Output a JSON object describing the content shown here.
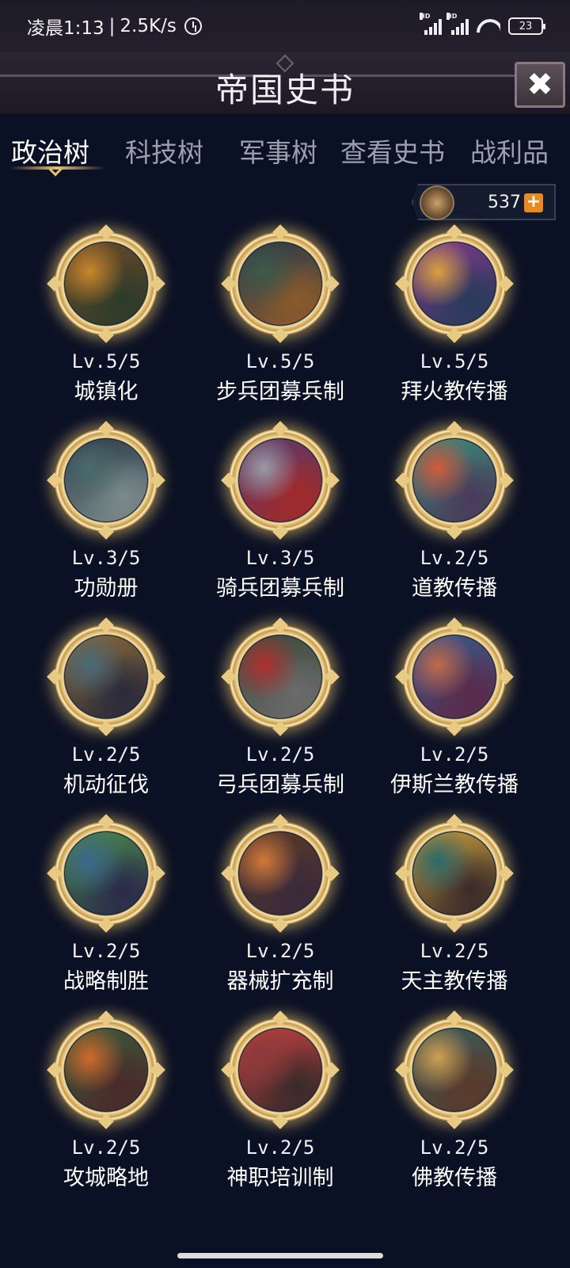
{
  "status_bar": {
    "time": "凌晨1:13",
    "separator": "|",
    "speed": "2.5K/s",
    "signal1_label": "HD",
    "signal2_label": "HD",
    "battery": "23"
  },
  "header": {
    "title": "帝国史书",
    "close_icon": "close-icon",
    "close_glyph": "✖"
  },
  "tabs": [
    {
      "label": "政治树",
      "active": true
    },
    {
      "label": "科技树",
      "active": false
    },
    {
      "label": "军事树",
      "active": false
    },
    {
      "label": "查看史书",
      "active": false
    },
    {
      "label": "战利品",
      "active": false
    }
  ],
  "currency": {
    "icon": "crest-icon",
    "value": "537",
    "plus": "+"
  },
  "items": [
    {
      "level": "Lv.5/5",
      "name": "城镇化",
      "colors": [
        "#c8862a",
        "#6a4a2a",
        "#2e3b2a"
      ]
    },
    {
      "level": "Lv.5/5",
      "name": "步兵团募兵制",
      "colors": [
        "#3c5a4a",
        "#2a3a4a",
        "#8a5a2a"
      ]
    },
    {
      "level": "Lv.5/5",
      "name": "拜火教传播",
      "colors": [
        "#d9a040",
        "#7a3a8a",
        "#2a3a5a"
      ]
    },
    {
      "level": "Lv.3/5",
      "name": "功勋册",
      "colors": [
        "#4a6a6a",
        "#2a3a4a",
        "#7a8a8a"
      ]
    },
    {
      "level": "Lv.3/5",
      "name": "骑兵团募兵制",
      "colors": [
        "#9a9aa8",
        "#5a3a6a",
        "#a02a2a"
      ]
    },
    {
      "level": "Lv.2/5",
      "name": "道教传播",
      "colors": [
        "#d05a3a",
        "#3a8a7a",
        "#4a3a5a"
      ]
    },
    {
      "level": "Lv.2/5",
      "name": "机动征伐",
      "colors": [
        "#4a6a7a",
        "#8a6a3a",
        "#2a2a3a"
      ]
    },
    {
      "level": "Lv.2/5",
      "name": "弓兵团募兵制",
      "colors": [
        "#b03030",
        "#3a4a3a",
        "#6a6a6a"
      ]
    },
    {
      "level": "Lv.2/5",
      "name": "伊斯兰教传播",
      "colors": [
        "#c06a4a",
        "#3a5a8a",
        "#5a2a4a"
      ]
    },
    {
      "level": "Lv.2/5",
      "name": "战略制胜",
      "colors": [
        "#3a6a8a",
        "#4a8a4a",
        "#2a2a4a"
      ]
    },
    {
      "level": "Lv.2/5",
      "name": "器械扩充制",
      "colors": [
        "#d07a3a",
        "#5a3a2a",
        "#3a2a3a"
      ]
    },
    {
      "level": "Lv.2/5",
      "name": "天主教传播",
      "colors": [
        "#2a6a6a",
        "#c09a3a",
        "#3a2a2a"
      ]
    },
    {
      "level": "Lv.2/5",
      "name": "攻城略地",
      "colors": [
        "#d06a2a",
        "#3a5a3a",
        "#4a2a2a"
      ]
    },
    {
      "level": "Lv.2/5",
      "name": "神职培训制",
      "colors": [
        "#8a3a3a",
        "#c04040",
        "#3a2a2a"
      ]
    },
    {
      "level": "Lv.2/5",
      "name": "佛教传播",
      "colors": [
        "#d0a050",
        "#3a5a5a",
        "#5a3a2a"
      ]
    }
  ],
  "theme": {
    "background": "#0b1124",
    "gold": "#e3c070",
    "accent_orange": "#e98a1f"
  }
}
